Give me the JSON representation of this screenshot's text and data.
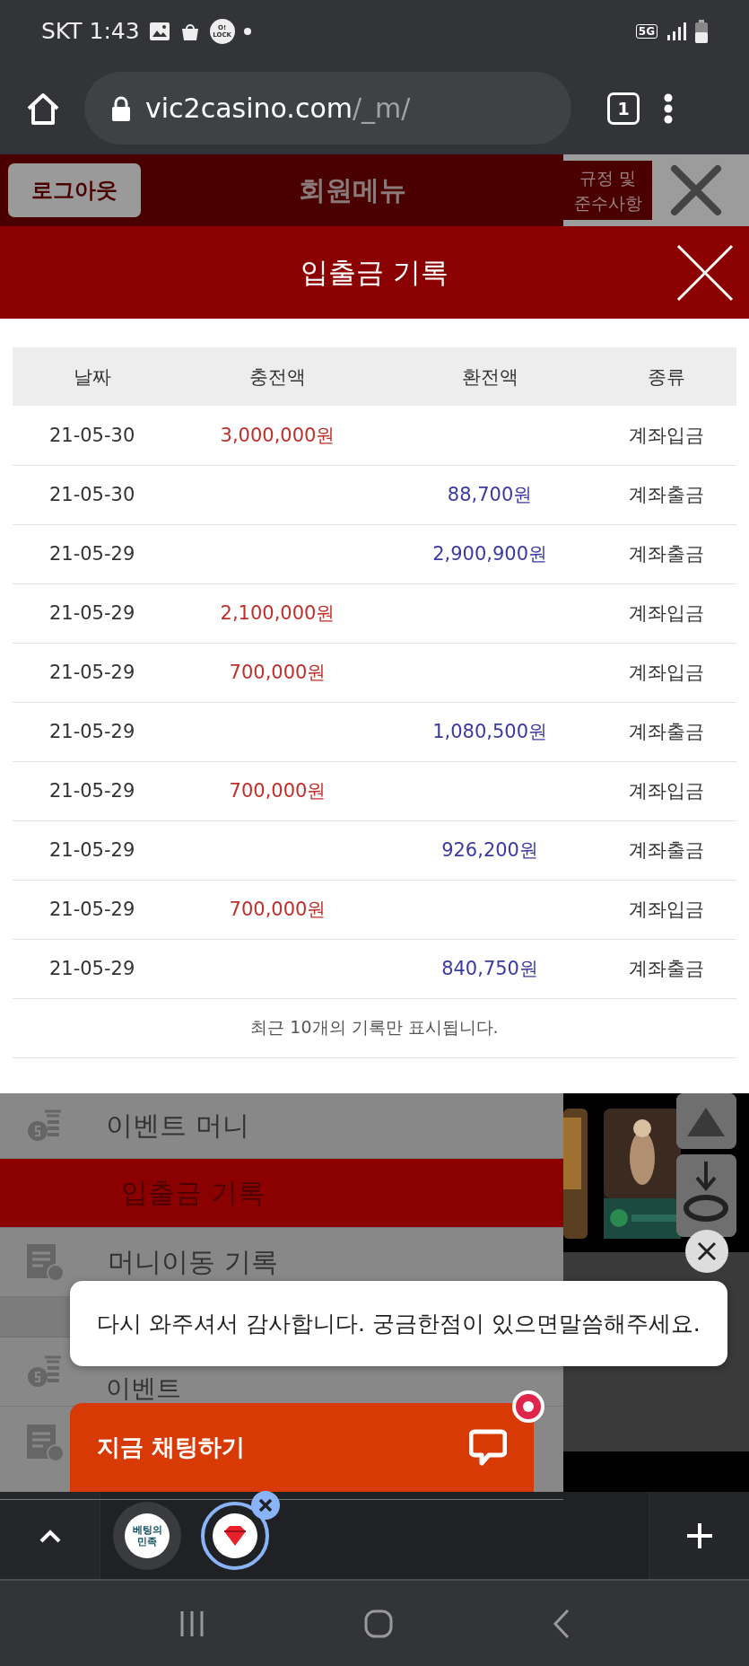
{
  "status_bar": {
    "carrier_time": "SKT 1:43",
    "app_badge": "O! LOCK",
    "network": "5G"
  },
  "browser": {
    "url_host": "vic2casino.com",
    "url_path": "/_m/",
    "tab_count": "1"
  },
  "member_menu": {
    "logout": "로그아웃",
    "title": "회원메뉴",
    "rules": "규정 및 준수사항"
  },
  "modal": {
    "title": "입출금 기록",
    "columns": [
      "날짜",
      "충전액",
      "환전액",
      "종류"
    ],
    "rows": [
      {
        "date": "21-05-30",
        "deposit": "3,000,000원",
        "withdrawal": "",
        "type": "계좌입금"
      },
      {
        "date": "21-05-30",
        "deposit": "",
        "withdrawal": "88,700원",
        "type": "계좌출금"
      },
      {
        "date": "21-05-29",
        "deposit": "",
        "withdrawal": "2,900,900원",
        "type": "계좌출금"
      },
      {
        "date": "21-05-29",
        "deposit": "2,100,000원",
        "withdrawal": "",
        "type": "계좌입금"
      },
      {
        "date": "21-05-29",
        "deposit": "700,000원",
        "withdrawal": "",
        "type": "계좌입금"
      },
      {
        "date": "21-05-29",
        "deposit": "",
        "withdrawal": "1,080,500원",
        "type": "계좌출금"
      },
      {
        "date": "21-05-29",
        "deposit": "700,000원",
        "withdrawal": "",
        "type": "계좌입금"
      },
      {
        "date": "21-05-29",
        "deposit": "",
        "withdrawal": "926,200원",
        "type": "계좌출금"
      },
      {
        "date": "21-05-29",
        "deposit": "700,000원",
        "withdrawal": "",
        "type": "계좌입금"
      },
      {
        "date": "21-05-29",
        "deposit": "",
        "withdrawal": "840,750원",
        "type": "계좌출금"
      }
    ],
    "note": "최근 10개의 기록만 표시됩니다."
  },
  "background_menu": {
    "items": [
      {
        "kind": "coins",
        "label": "이벤트 머니",
        "selected": false
      },
      {
        "kind": "plain",
        "label": "입출금 기록",
        "selected": true
      },
      {
        "kind": "document",
        "label": "머니이동 기록",
        "selected": false
      },
      {
        "kind": "separator"
      },
      {
        "kind": "coins",
        "label": "이벤트",
        "selected": false
      },
      {
        "kind": "document",
        "selected": false
      }
    ]
  },
  "toast": {
    "message": "다시 와주셔서 감사합니다. 궁금한점이 있으면말씀해주세요."
  },
  "chat_button": {
    "label": "지금 채팅하기"
  },
  "tab_bar": {
    "tabs": [
      {
        "favicon_text": "베팅의 민족",
        "selected": false
      },
      {
        "selected": true
      }
    ]
  }
}
